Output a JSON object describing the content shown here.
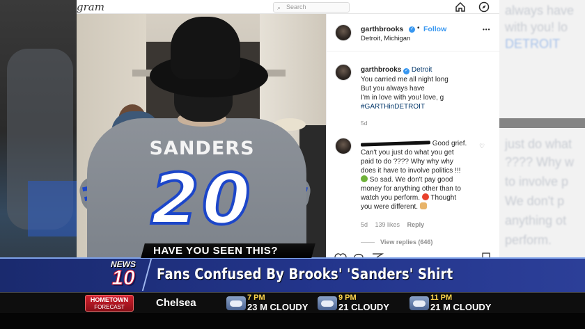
{
  "instagram": {
    "logo": "gram",
    "search_placeholder": "Search"
  },
  "post": {
    "photo": {
      "jersey_name": "SANDERS",
      "jersey_number": "20"
    },
    "header": {
      "username": "garthbrooks",
      "separator": "•",
      "follow_label": "Follow",
      "location": "Detroit, Michigan",
      "more_label": "•••"
    },
    "caption": {
      "username": "garthbrooks",
      "location_tag": "Detroit",
      "lines": [
        "You carried me all night long",
        "But you always have",
        "I'm in love with you! love, g"
      ],
      "hashtag": "#GARTHinDETROIT",
      "age": "5d"
    },
    "comment": {
      "text_1": " Good grief.",
      "text_2": "Can't you just do what you get",
      "text_3": "paid to do ???? Why why why",
      "text_4": "does it have to involve politics !!!",
      "text_5": " So sad. We don't pay good",
      "text_6": "money for anything other than to",
      "text_7": "watch you perform.",
      "text_8": " Thought",
      "text_9": "you were different.",
      "age": "5d",
      "likes": "139 likes",
      "reply_label": "Reply",
      "view_replies": "View replies (646)"
    }
  },
  "lower_third": {
    "question": "HAVE YOU SEEN THIS?",
    "station_word": "NEWS",
    "station_number": "10",
    "headline": "Fans Confused By Brooks' 'Sanders' Shirt"
  },
  "weather": {
    "badge_line1": "HOMETOWN",
    "badge_line2": "FORECAST",
    "city": "Chelsea",
    "forecasts": [
      {
        "time": "7 PM",
        "desc": "23 M CLOUDY",
        "icon": "cloud-icon"
      },
      {
        "time": "9 PM",
        "desc": "21 CLOUDY",
        "icon": "haze-icon"
      },
      {
        "time": "11 PM",
        "desc": "21 M CLOUDY",
        "icon": "cloud-icon"
      }
    ]
  },
  "colors": {
    "instagram_blue": "#3897f0",
    "lower_third_blue": "#23358c",
    "jersey_blue": "#1c46c9",
    "badge_red": "#d1202e",
    "forecast_time_yellow": "#ffd64a"
  }
}
